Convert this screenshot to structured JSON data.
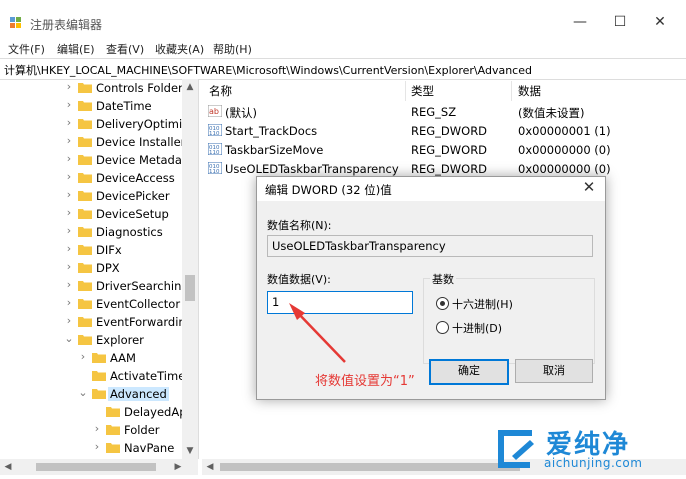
{
  "window": {
    "title": "注册表编辑器",
    "minimize": "—",
    "maximize": "☐",
    "close": "✕"
  },
  "menu": [
    "文件(F)",
    "编辑(E)",
    "查看(V)",
    "收藏夹(A)",
    "帮助(H)"
  ],
  "address": "计算机\\HKEY_LOCAL_MACHINE\\SOFTWARE\\Microsoft\\Windows\\CurrentVersion\\Explorer\\Advanced",
  "tree": [
    {
      "label": "Controls Folder",
      "expander": "chevron-right-icon"
    },
    {
      "label": "DateTime",
      "expander": "chevron-right-icon"
    },
    {
      "label": "DeliveryOptimiza",
      "expander": "chevron-right-icon"
    },
    {
      "label": "Device Installer",
      "expander": "chevron-right-icon"
    },
    {
      "label": "Device Metadata",
      "expander": "chevron-right-icon"
    },
    {
      "label": "DeviceAccess",
      "expander": "chevron-right-icon"
    },
    {
      "label": "DevicePicker",
      "expander": "chevron-right-icon"
    },
    {
      "label": "DeviceSetup",
      "expander": "chevron-right-icon"
    },
    {
      "label": "Diagnostics",
      "expander": "chevron-right-icon"
    },
    {
      "label": "DIFx",
      "expander": "chevron-right-icon"
    },
    {
      "label": "DPX",
      "expander": "chevron-right-icon"
    },
    {
      "label": "DriverSearching",
      "expander": "chevron-right-icon"
    },
    {
      "label": "EventCollector",
      "expander": "chevron-right-icon"
    },
    {
      "label": "EventForwarding",
      "expander": "chevron-right-icon"
    },
    {
      "label": "Explorer",
      "expander": "chevron-down-icon"
    },
    {
      "label": "AAM",
      "expander": "chevron-right-icon"
    },
    {
      "label": "ActivateTimec",
      "expander": "none"
    },
    {
      "label": "Advanced",
      "expander": "chevron-down-icon",
      "selected": true
    },
    {
      "label": "DelayedAp",
      "expander": "none"
    },
    {
      "label": "Folder",
      "expander": "chevron-right-icon"
    },
    {
      "label": "NavPane",
      "expander": "chevron-right-icon"
    }
  ],
  "list": {
    "headers": {
      "name": "名称",
      "type": "类型",
      "data": "数据"
    },
    "rows": [
      {
        "icon": "string-value-icon",
        "name": "(默认)",
        "type": "REG_SZ",
        "data": "(数值未设置)"
      },
      {
        "icon": "binary-value-icon",
        "name": "Start_TrackDocs",
        "type": "REG_DWORD",
        "data": "0x00000001 (1)"
      },
      {
        "icon": "binary-value-icon",
        "name": "TaskbarSizeMove",
        "type": "REG_DWORD",
        "data": "0x00000000 (0)"
      },
      {
        "icon": "binary-value-icon",
        "name": "UseOLEDTaskbarTransparency",
        "type": "REG_DWORD",
        "data": "0x00000000 (0)"
      }
    ]
  },
  "dialog": {
    "title": "编辑 DWORD (32 位)值",
    "close": "✕",
    "name_label": "数值名称(N):",
    "name_value": "UseOLEDTaskbarTransparency",
    "data_label": "数值数据(V):",
    "data_value": "1",
    "base_label": "基数",
    "base_options": [
      {
        "label": "十六进制(H)",
        "checked": true
      },
      {
        "label": "十进制(D)",
        "checked": false
      }
    ],
    "ok_label": "确定",
    "cancel_label": "取消"
  },
  "annotation": "将数值设置为“1”",
  "watermark": {
    "brand": "爱纯净",
    "url": "aichunjing.com",
    "color": "#1e88d6"
  },
  "colors": {
    "selection": "#cce8ff",
    "focus": "#0078d7",
    "annotation": "#e53935",
    "folder": "#f5c542"
  }
}
